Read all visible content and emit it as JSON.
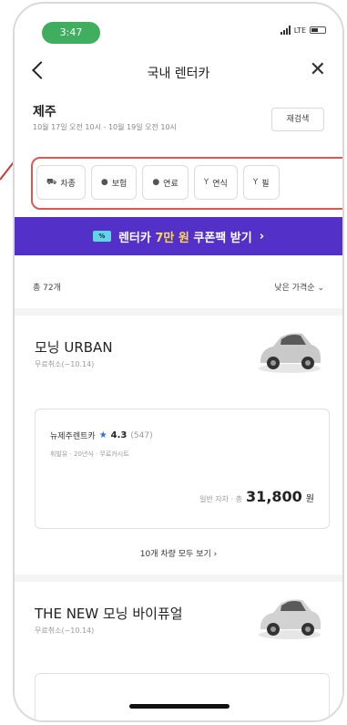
{
  "status_bar": {
    "time": "3:47",
    "network": "LTE"
  },
  "nav": {
    "title": "국내 렌터카"
  },
  "search": {
    "region": "제주",
    "dates": "10월 17일 오전 10시 - 10월 19일 오전 10시",
    "research_label": "재검색"
  },
  "filters": [
    {
      "icon": "car-icon",
      "glyph": "⛟",
      "label": "차종"
    },
    {
      "icon": "shield-icon",
      "glyph": "●",
      "label": "보험"
    },
    {
      "icon": "fuel-icon",
      "glyph": "●",
      "label": "연료"
    },
    {
      "icon": "filter-icon",
      "glyph": "Y",
      "label": "연식"
    },
    {
      "icon": "filter-icon",
      "glyph": "Y",
      "label": "필"
    }
  ],
  "coupon": {
    "badge": "%",
    "text_prefix": "렌터카 ",
    "highlight": "7만 원",
    "text_suffix": " 쿠폰팩 받기",
    "arrow": "›"
  },
  "list": {
    "total": "총 72개",
    "sort": "낮은 가격순 ⌄"
  },
  "cars": [
    {
      "name": "모닝 URBAN",
      "sub": "무료취소(~10.14)",
      "vendor": {
        "name": "뉴제주렌트카",
        "rating": "4.3",
        "reviews": "(547)",
        "tags": "휘발유 · 20년식 · 무료카시트",
        "price_label": "일반 자차 · 총",
        "price": "31,800",
        "unit": "원"
      },
      "see_all": "10개 차량 모두 보기 ›"
    },
    {
      "name": "THE NEW 모닝 바이퓨얼",
      "sub": "무료취소(~10.14)"
    }
  ],
  "colors": {
    "brand_purple": "#5330c7",
    "status_green": "#3fae5e",
    "highlight_red": "#d85a55",
    "rating_blue": "#2f6fe4"
  }
}
